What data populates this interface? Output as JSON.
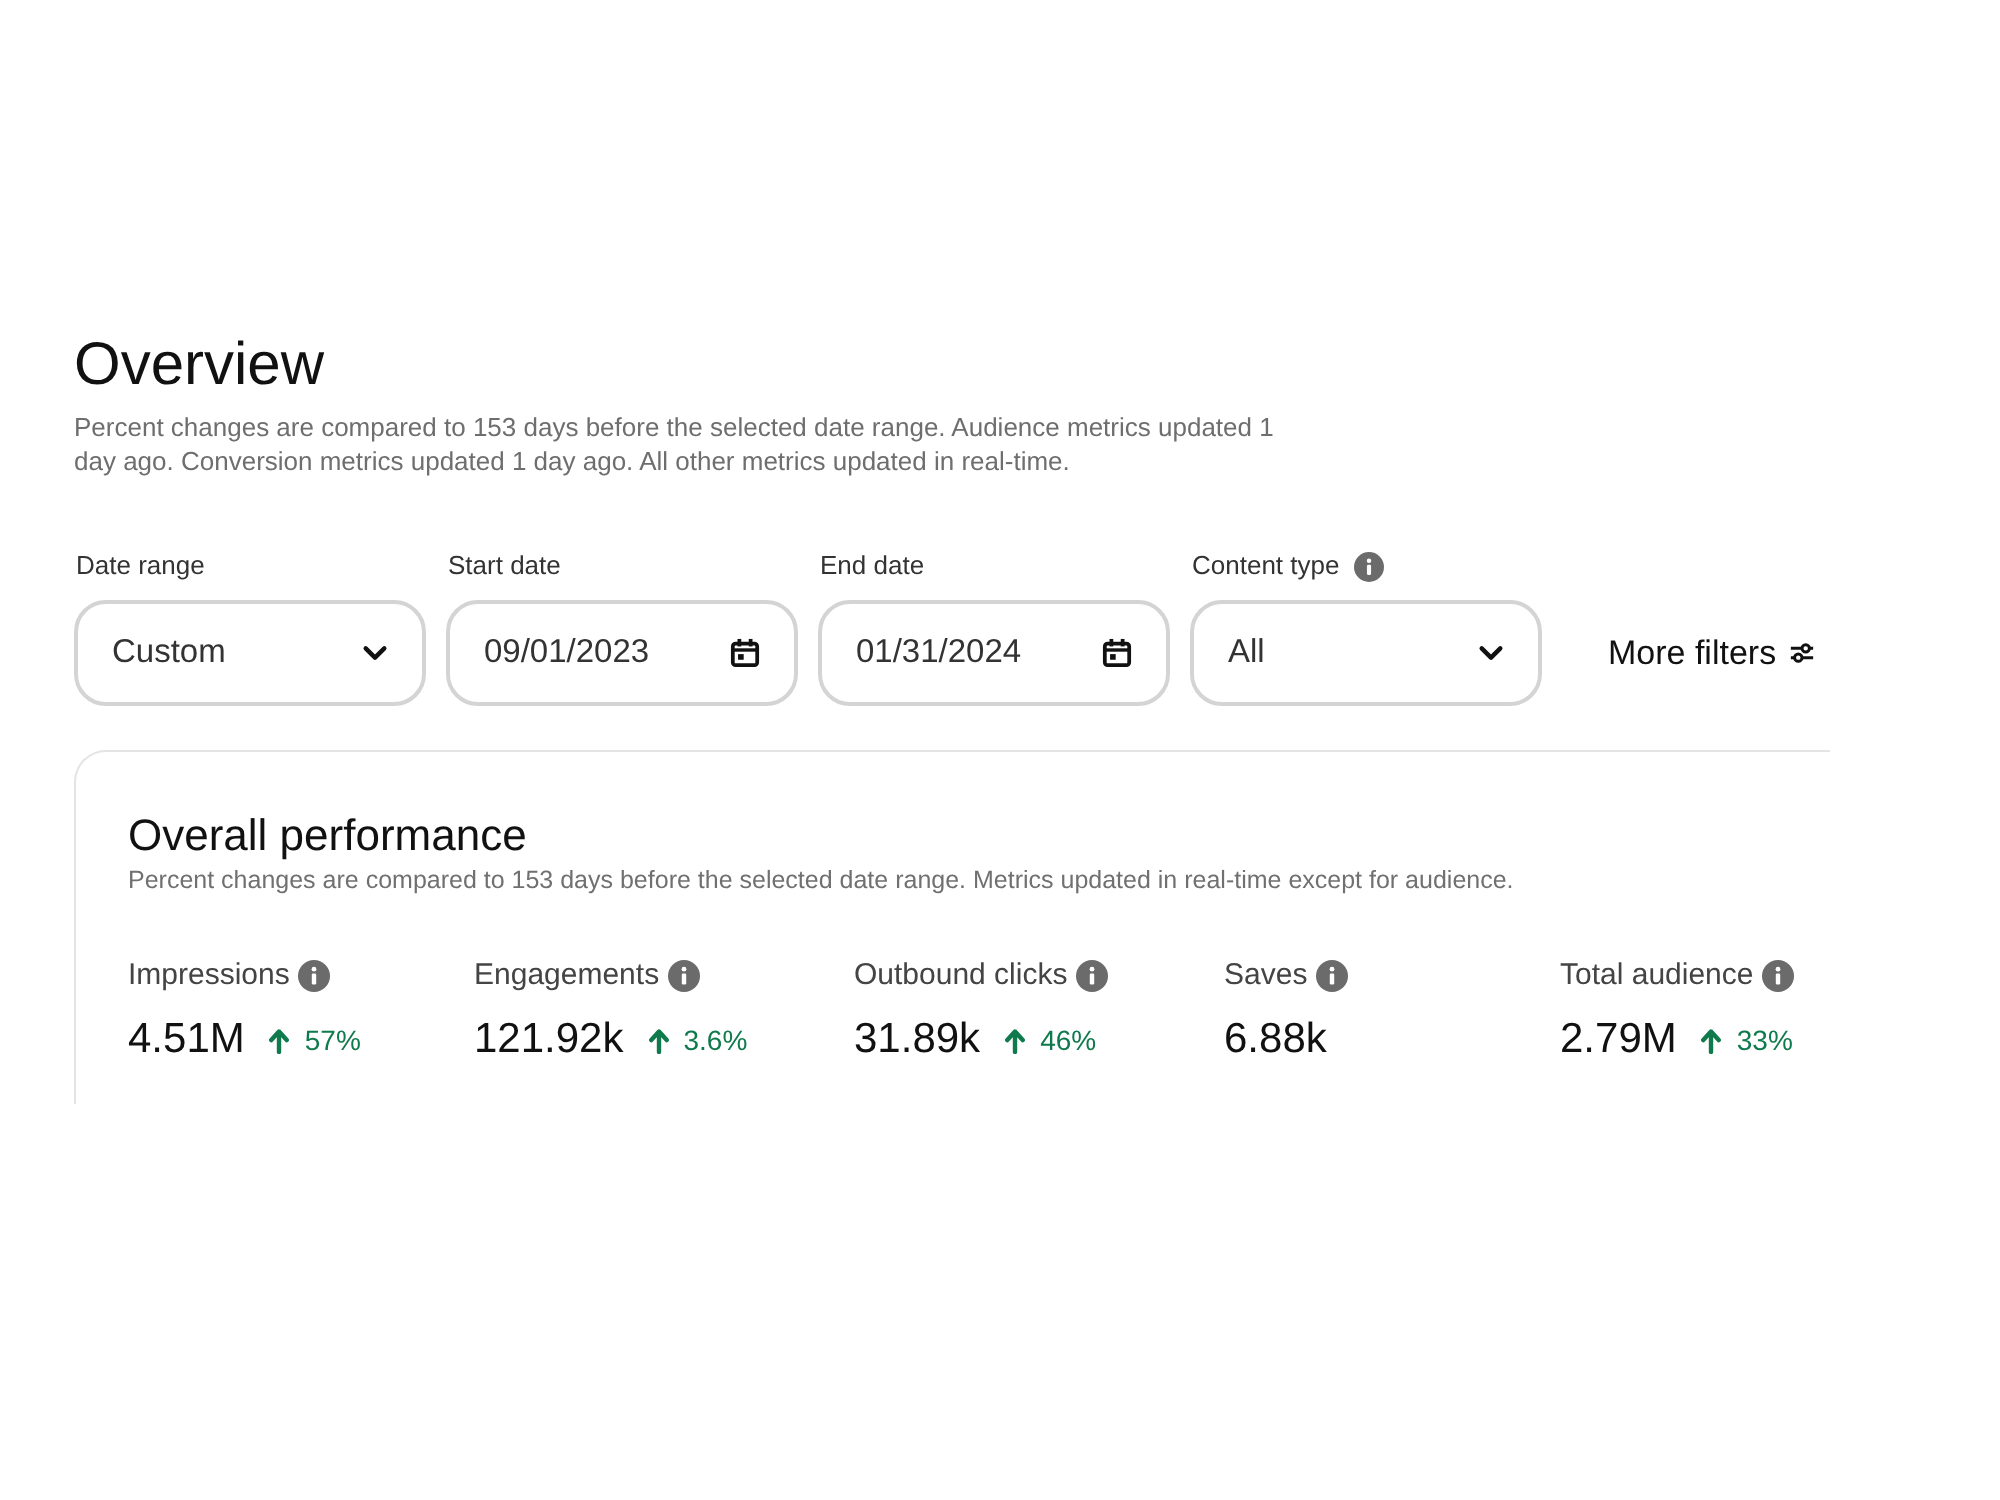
{
  "header": {
    "title": "Overview",
    "description": "Percent changes are compared to 153 days before the selected date range. Audience metrics updated 1 day ago. Conversion metrics updated 1 day ago. All other metrics updated in real-time."
  },
  "filters": [
    {
      "label": "Date range",
      "info": false,
      "kind": "select",
      "value": "Custom"
    },
    {
      "label": "Start date",
      "info": false,
      "kind": "date",
      "value": "09/01/2023"
    },
    {
      "label": "End date",
      "info": false,
      "kind": "date",
      "value": "01/31/2024"
    },
    {
      "label": "Content type",
      "info": true,
      "kind": "select",
      "value": "All"
    }
  ],
  "more_filters": {
    "label": "More filters"
  },
  "overall_performance": {
    "title": "Overall performance",
    "description": "Percent changes are compared to 153 days before the selected date range. Metrics updated in real-time except for audience.",
    "metrics": [
      {
        "label": "Impressions",
        "info": true,
        "value": "4.51M",
        "change": {
          "kind": "up",
          "value": "57%"
        }
      },
      {
        "label": "Engagements",
        "info": true,
        "value": "121.92k",
        "change": {
          "kind": "up",
          "value": "3.6%"
        }
      },
      {
        "label": "Outbound clicks",
        "info": true,
        "value": "31.89k",
        "change": {
          "kind": "up",
          "value": "46%"
        }
      },
      {
        "label": "Saves",
        "info": true,
        "value": "6.88k"
      },
      {
        "label": "Total audience",
        "info": true,
        "value": "2.79M",
        "change": {
          "kind": "up",
          "value": "33%"
        }
      }
    ]
  }
}
